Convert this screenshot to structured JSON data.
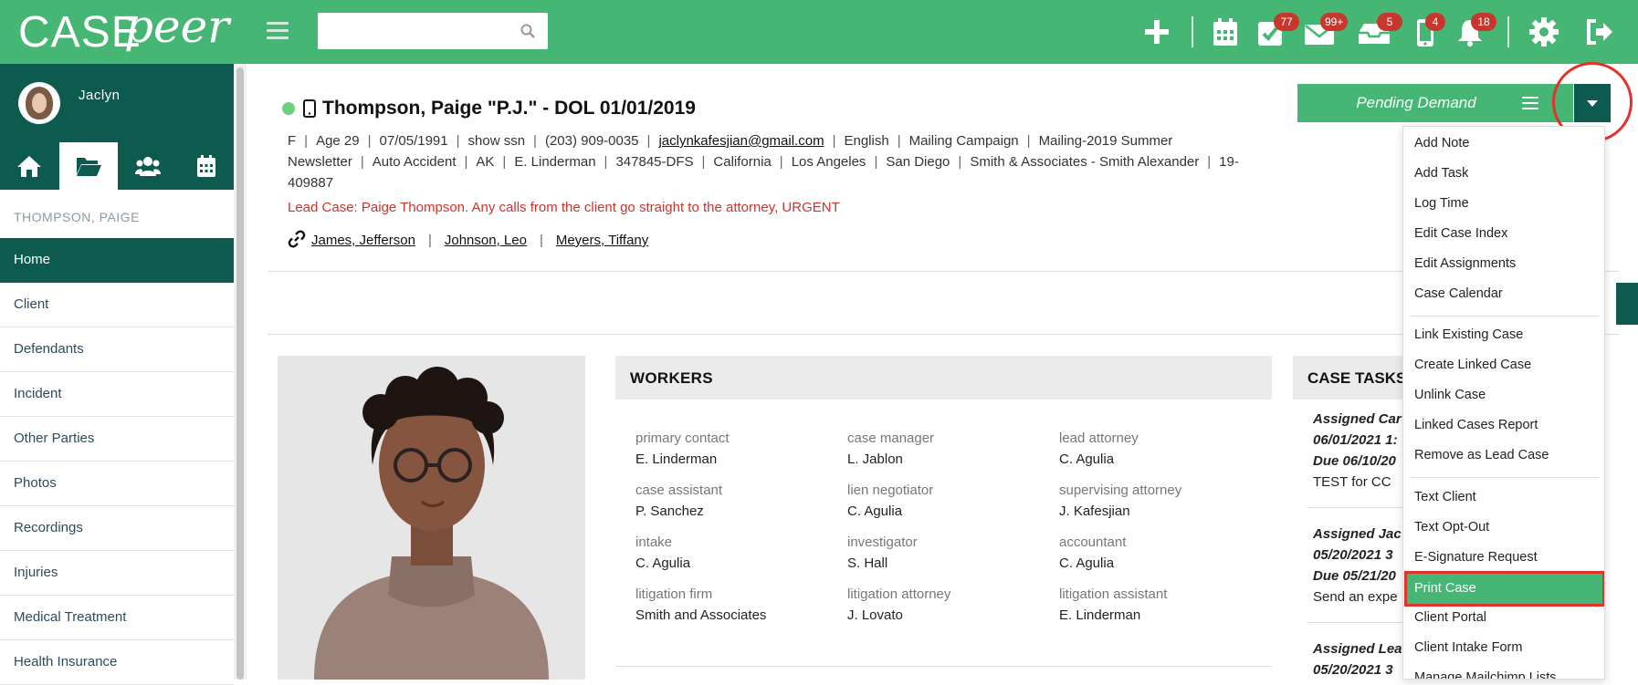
{
  "app": {
    "logo_case": "CASE",
    "logo_peer": "peer",
    "search": {
      "placeholder": "",
      "value": ""
    },
    "badges": {
      "tasks": "77",
      "mail": "99+",
      "inbox": "5",
      "sms": "4",
      "notifications": "18"
    },
    "accent": "#45b673",
    "dark": "#0d5b4f",
    "alert": "#d0332a"
  },
  "sidebar": {
    "user_name": "Jaclyn",
    "case_label": "THOMPSON, PAIGE",
    "items": [
      "Home",
      "Client",
      "Defendants",
      "Incident",
      "Other Parties",
      "Photos",
      "Recordings",
      "Injuries",
      "Medical Treatment",
      "Health Insurance"
    ]
  },
  "case": {
    "title": "Thompson, Paige \"P.J.\" - DOL 01/01/2019",
    "info": {
      "gender": "F",
      "age": "Age 29",
      "dob": "07/05/1991",
      "ssn": "show ssn",
      "phone": "(203) 909-0035",
      "email": "jaclynkafesjian@gmail.com",
      "language": "English",
      "source": "Mailing Campaign",
      "campaign": "Mailing-2019 Summer Newsletter",
      "case_type": "Auto Accident",
      "initials": "AK",
      "worker": "E. Linderman",
      "case_no": "347845-DFS",
      "state": "California",
      "county": "Los Angeles",
      "office": "San Diego",
      "firm": "Smith & Associates - Smith Alexander",
      "file_no": "19-409887"
    },
    "lead_case": "Lead Case: Paige Thompson. Any calls from the client go straight to the attorney, URGENT",
    "linked": [
      "James, Jefferson",
      "Johnson, Leo",
      "Meyers, Tiffany"
    ],
    "status": "Pending Demand"
  },
  "dropdown": {
    "group1": [
      "Add Note",
      "Add Task",
      "Log Time",
      "Edit Case Index",
      "Edit Assignments",
      "Case Calendar"
    ],
    "group2": [
      "Link Existing Case",
      "Create Linked Case",
      "Unlink Case",
      "Linked Cases Report",
      "Remove as Lead Case"
    ],
    "group3": [
      "Text Client",
      "Text Opt-Out",
      "E-Signature Request",
      "Print Case",
      "Client Portal",
      "Client Intake Form",
      "Manage Mailchimp Lists"
    ]
  },
  "workers": {
    "title": "WORKERS",
    "cells": [
      {
        "role": "primary contact",
        "name": "E. Linderman"
      },
      {
        "role": "case manager",
        "name": "L. Jablon"
      },
      {
        "role": "lead attorney",
        "name": "C. Agulia"
      },
      {
        "role": "case assistant",
        "name": "P. Sanchez"
      },
      {
        "role": "lien negotiator",
        "name": "C. Agulia"
      },
      {
        "role": "supervising attorney",
        "name": "J. Kafesjian"
      },
      {
        "role": "intake",
        "name": "C. Agulia"
      },
      {
        "role": "investigator",
        "name": "S. Hall"
      },
      {
        "role": "accountant",
        "name": "C. Agulia"
      },
      {
        "role": "litigation firm",
        "name": "Smith and Associates"
      },
      {
        "role": "litigation attorney",
        "name": "J. Lovato"
      },
      {
        "role": "litigation assistant",
        "name": "E. Linderman"
      }
    ]
  },
  "tasks": {
    "title": "CASE TASKS",
    "items": [
      {
        "l1": "Assigned Car",
        "l2": "06/01/2021 1:",
        "l3": "Due 06/10/20",
        "l4": "TEST for CC"
      },
      {
        "l1": "Assigned Jac",
        "l2": "05/20/2021 3",
        "l3": "Due 05/21/20",
        "l4": "Send an expe"
      },
      {
        "l1": "Assigned Lea",
        "l2": "05/20/2021 3",
        "l3": "",
        "l4": ""
      }
    ]
  }
}
